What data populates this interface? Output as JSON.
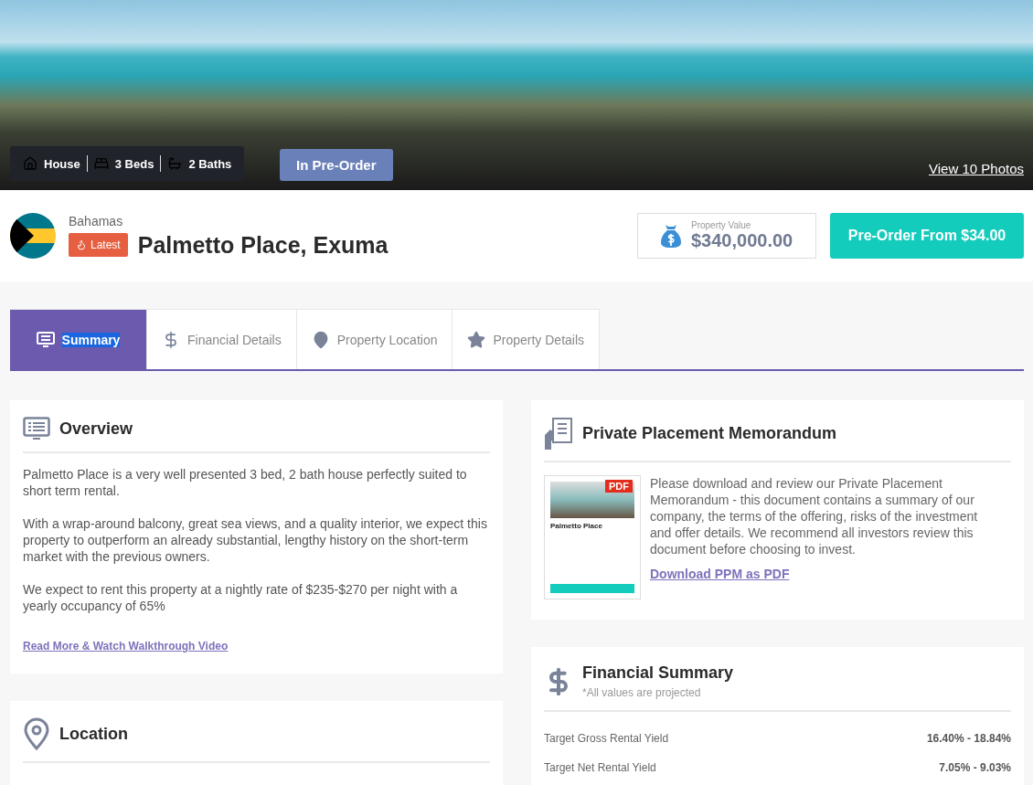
{
  "hero": {
    "features": [
      {
        "kind": "house",
        "label": "House"
      },
      {
        "kind": "bed",
        "label": "3 Beds"
      },
      {
        "kind": "bath",
        "label": "2 Baths"
      }
    ],
    "status": "In Pre-Order",
    "photos_link": "View 10 Photos"
  },
  "header": {
    "country": "Bahamas",
    "tag": "Latest",
    "title": "Palmetto Place, Exuma",
    "value_label": "Property Value",
    "value": "$340,000.00",
    "cta": "Pre-Order From $34.00"
  },
  "tabs": [
    {
      "kind": "summary",
      "label": "Summary",
      "selected": true
    },
    {
      "kind": "financial",
      "label": "Financial Details",
      "selected": false
    },
    {
      "kind": "location",
      "label": "Property Location",
      "selected": false
    },
    {
      "kind": "details",
      "label": "Property Details",
      "selected": false
    }
  ],
  "overview": {
    "title": "Overview",
    "paragraphs": [
      "Palmetto Place is a very well presented 3 bed, 2 bath house perfectly suited to short term rental.",
      "With a wrap-around balcony, great sea views, and a quality interior, we expect this property to outperform an already substantial, lengthy history on the short-term market with the previous owners.",
      "We expect to rent this property at a nightly rate of $235-$270 per night with a yearly occupancy of 65%"
    ],
    "link": "Read More & Watch Walkthrough Video"
  },
  "location": {
    "title": "Location"
  },
  "ppm": {
    "title": "Private Placement Memorandum",
    "thumb_badge": "PDF",
    "thumb_title": "Palmetto Place",
    "text": "Please download and review our Private Placement Memorandum - this document contains a summary of our company, the terms of the offering, risks of the investment and offer details. We recommend all investors review this document before choosing to invest.",
    "link": "Download PPM as PDF"
  },
  "financial_summary": {
    "title": "Financial Summary",
    "note": "*All values are projected",
    "rows": [
      {
        "label": "Target Gross Rental Yield",
        "value": "16.40% - 18.84%"
      },
      {
        "label": "Target Net Rental Yield",
        "value": "7.05% - 9.03%"
      }
    ]
  }
}
